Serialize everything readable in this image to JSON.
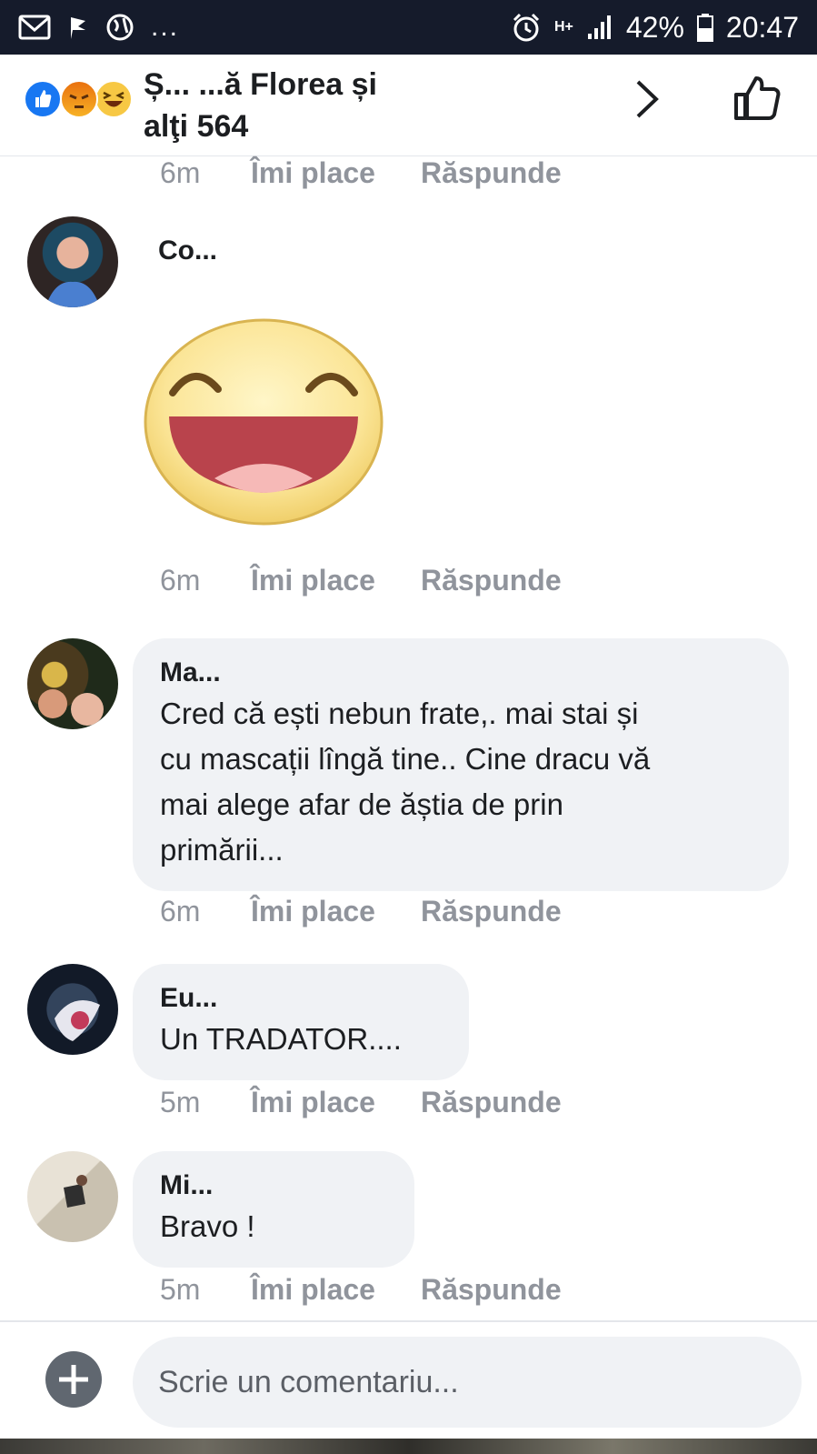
{
  "status_bar": {
    "network": "H+",
    "battery": "42%",
    "time": "20:47",
    "overflow": "..."
  },
  "header": {
    "title_line1": "Ș... ...ă Florea și",
    "title_line2": "alţi 564",
    "reactions": [
      "like",
      "angry",
      "haha"
    ]
  },
  "comments": [
    {
      "time": "6m",
      "like_label": "Îmi place",
      "reply_label": "Răspunde"
    },
    {
      "author": "Co...",
      "sticker": "laughing-face-sticker",
      "time": "6m",
      "like_label": "Îmi place",
      "reply_label": "Răspunde"
    },
    {
      "author": "Ma...",
      "text": "Cred că ești nebun frate,.  mai stai și\ncu mascații lîngă tine.. Cine dracu vă\nmai alege afar de ăștia de prin\nprimării...",
      "time": "6m",
      "like_label": "Îmi place",
      "reply_label": "Răspunde"
    },
    {
      "author": "Eu...",
      "text": "Un TRADATOR....",
      "time": "5m",
      "like_label": "Îmi place",
      "reply_label": "Răspunde"
    },
    {
      "author": "Mi...",
      "text": "Bravo !",
      "time": "5m",
      "like_label": "Îmi place",
      "reply_label": "Răspunde"
    }
  ],
  "composer": {
    "placeholder": "Scrie un comentariu..."
  },
  "colors": {
    "status_bar_bg": "#151b2b",
    "bubble_bg": "#f0f2f5",
    "meta_text": "#90949c",
    "like_blue": "#1877f2"
  }
}
